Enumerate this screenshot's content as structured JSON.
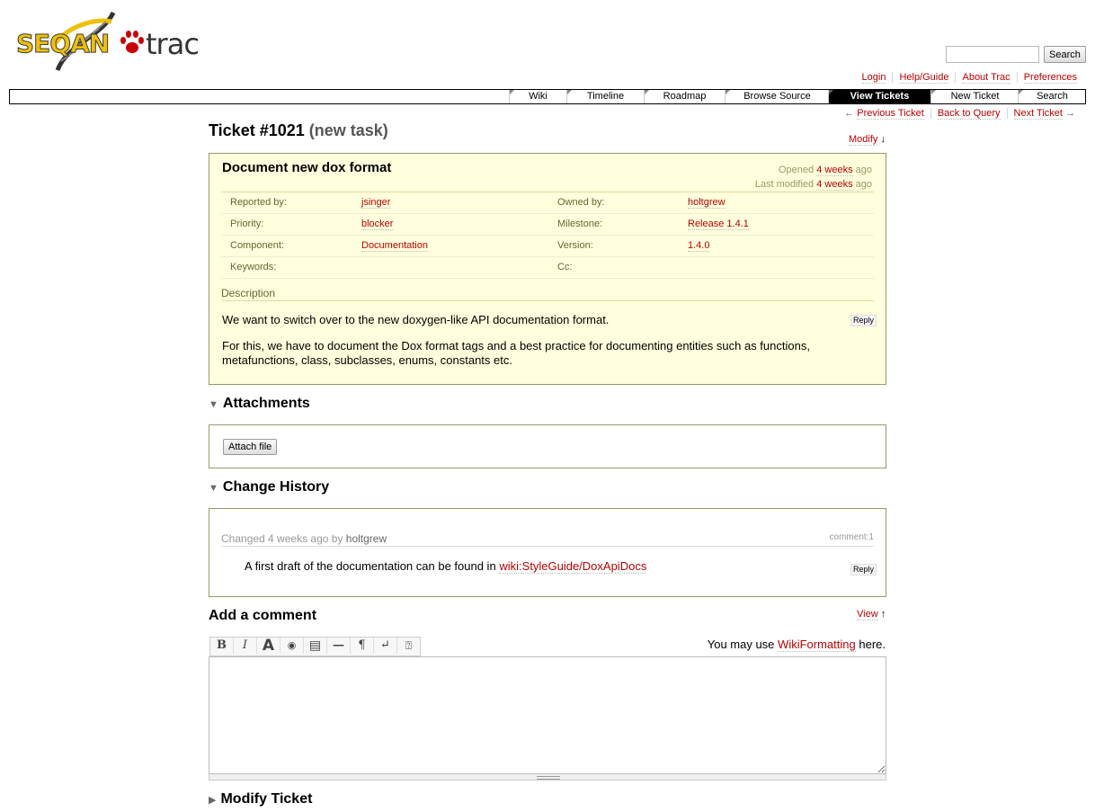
{
  "brand": {
    "logo_text": "SEQAN",
    "product": "trac"
  },
  "search": {
    "button_label": "Search",
    "placeholder": ""
  },
  "metanav": [
    "Login",
    "Help/Guide",
    "About Trac",
    "Preferences"
  ],
  "mainnav": {
    "tabs": [
      "Wiki",
      "Timeline",
      "Roadmap",
      "Browse Source",
      "View Tickets",
      "New Ticket",
      "Search"
    ],
    "active": "View Tickets"
  },
  "ctxtnav": {
    "previous": "Previous Ticket",
    "back": "Back to Query",
    "next": "Next Ticket",
    "left_arrow": "←",
    "right_arrow": "→"
  },
  "ticket": {
    "title": "Ticket #1021",
    "type": "(new task)",
    "modify_label": "Modify",
    "down_arrow": "↓",
    "summary": "Document new dox format",
    "opened_prefix": "Opened",
    "opened_when": "4 weeks",
    "opened_suffix": "ago",
    "modified_prefix": "Last modified",
    "modified_when": "4 weeks",
    "modified_suffix": "ago",
    "props": {
      "reported_by_label": "Reported by:",
      "reported_by": "jsinger",
      "owned_by_label": "Owned by:",
      "owned_by": "holtgrew",
      "priority_label": "Priority:",
      "priority": "blocker",
      "milestone_label": "Milestone:",
      "milestone": "Release 1.4.1",
      "component_label": "Component:",
      "component": "Documentation",
      "version_label": "Version:",
      "version": "1.4.0",
      "keywords_label": "Keywords:",
      "keywords": "",
      "cc_label": "Cc:",
      "cc": ""
    },
    "description_label": "Description",
    "description_p1": "We want to switch over to the new doxygen-like API documentation format.",
    "description_p2": "For this, we have to document the Dox format tags and a best practice for documenting entities such as functions, metafunctions, class, subclasses, enums, constants etc.",
    "reply_label": "Reply"
  },
  "attachments": {
    "heading": "Attachments",
    "attach_button": "Attach file",
    "tri": "▼"
  },
  "history": {
    "heading": "Change History",
    "tri": "▼",
    "change_prefix": "Changed 4 weeks ago by",
    "author": "holtgrew",
    "comment_num": "comment:1",
    "comment_text": "A first draft of the documentation can be found in",
    "comment_link": "wiki:StyleGuide/DoxApiDocs",
    "reply_label": "Reply"
  },
  "comment": {
    "heading": "Add a comment",
    "view_label": "View",
    "up_arrow": "↑",
    "hint_prefix": "You may use",
    "hint_link": "WikiFormatting",
    "hint_suffix": "here.",
    "toolbar": [
      "B",
      "I",
      "A",
      "◉",
      "▤",
      "—",
      "¶",
      "↵",
      "⍰"
    ]
  },
  "modify": {
    "heading": "Modify Ticket",
    "tri": "▶"
  }
}
